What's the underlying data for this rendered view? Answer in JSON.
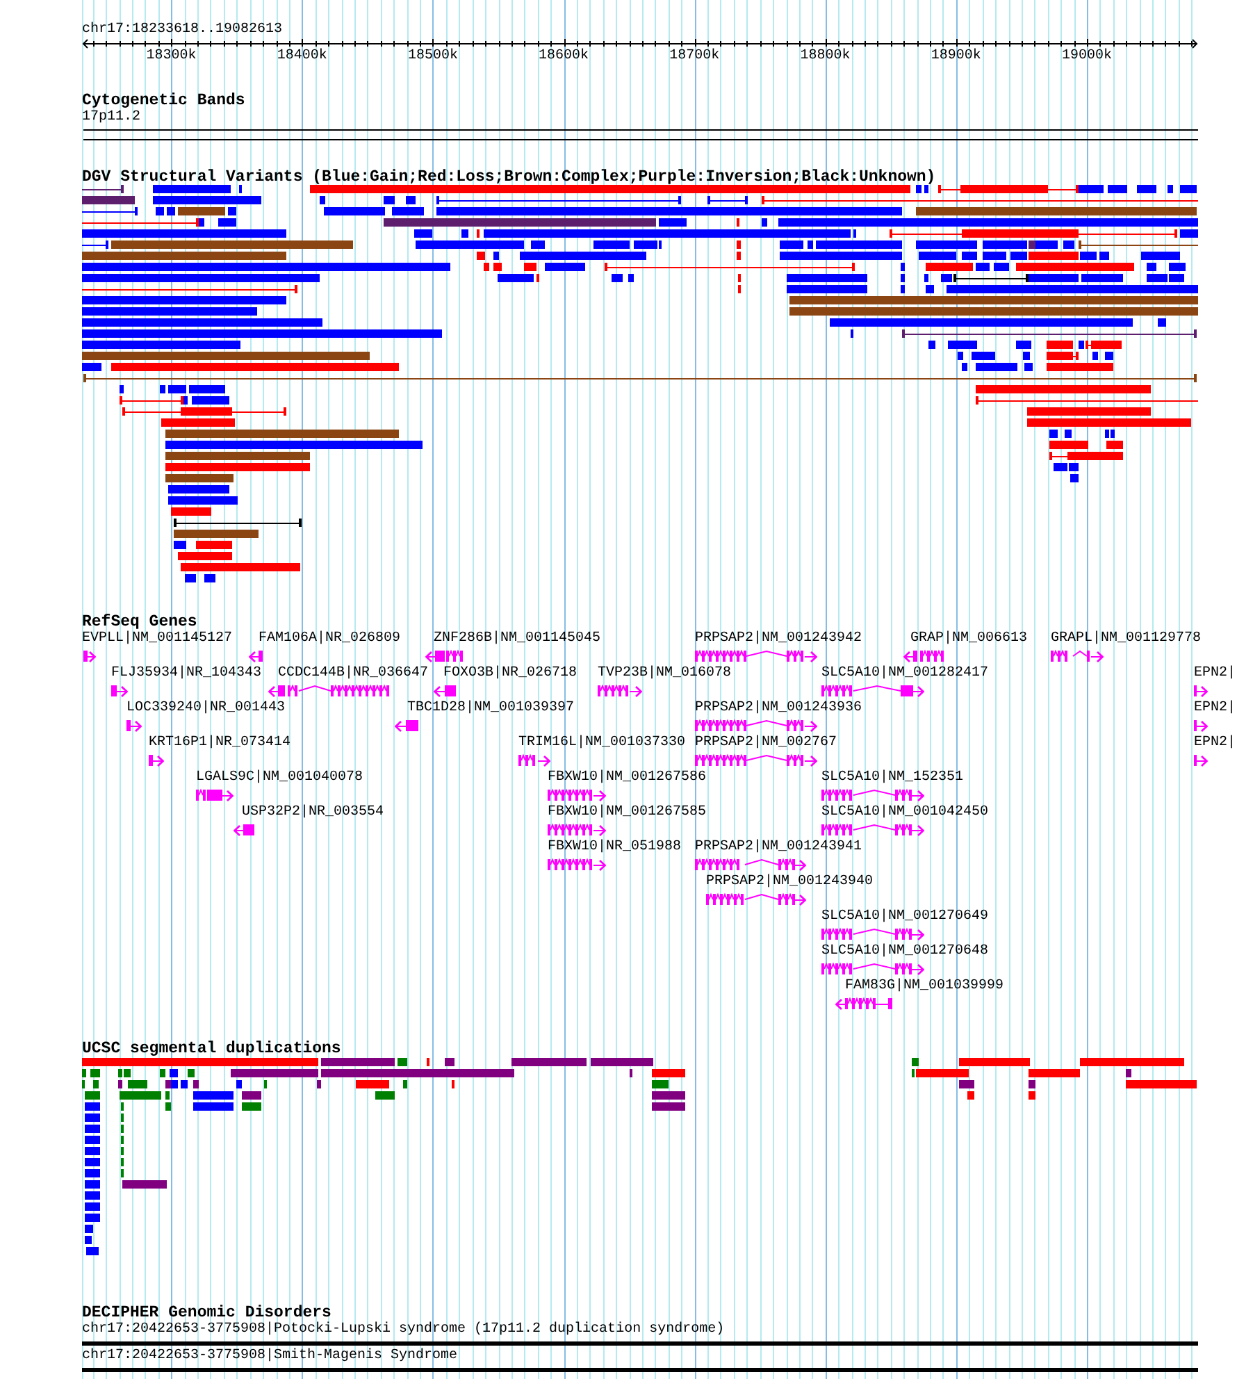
{
  "ruler": {
    "region": "chr17:18233618..19082613",
    "ticks": [
      "18300k",
      "18400k",
      "18500k",
      "18600k",
      "18700k",
      "18800k",
      "18900k",
      "19000k"
    ]
  },
  "cytogenetic_bands": {
    "title": "Cytogenetic Bands",
    "bands": [
      {
        "label": "17p11.2"
      }
    ]
  },
  "dgv_structural_variants": {
    "title": "DGV Structural Variants (Blue:Gain;Red:Loss;Brown:Complex;Purple:Inversion;Black:Unknown)",
    "features": [
      {
        "color": "#5e1e6e",
        "kind": "span"
      },
      {
        "color": "#0000ff",
        "kind": "block"
      },
      {
        "color": "#0000ff",
        "kind": "block"
      },
      {
        "color": "#ff0000",
        "kind": "block"
      },
      {
        "color": "#0000ff",
        "kind": "block"
      },
      {
        "color": "#0000ff",
        "kind": "block"
      },
      {
        "color": "#ff0000",
        "kind": "span"
      },
      {
        "color": "#ff0000",
        "kind": "block"
      },
      {
        "color": "#0000ff",
        "kind": "block"
      },
      {
        "color": "#0000ff",
        "kind": "block"
      },
      {
        "color": "#0000ff",
        "kind": "block"
      },
      {
        "color": "#0000ff",
        "kind": "block"
      },
      {
        "color": "#0000ff",
        "kind": "block"
      },
      {
        "color": "#5e1e6e",
        "kind": "block"
      },
      {
        "color": "#0000ff",
        "kind": "block"
      },
      {
        "color": "#0000ff",
        "kind": "block"
      },
      {
        "color": "#0000ff",
        "kind": "block"
      },
      {
        "color": "#0000ff",
        "kind": "block"
      },
      {
        "color": "#0000ff",
        "kind": "span"
      },
      {
        "color": "#0000ff",
        "kind": "span"
      },
      {
        "color": "#ff0000",
        "kind": "span"
      },
      {
        "color": "#0000ff",
        "kind": "span"
      },
      {
        "color": "#0000ff",
        "kind": "block"
      },
      {
        "color": "#0000ff",
        "kind": "block"
      },
      {
        "color": "#8b4513",
        "kind": "block"
      },
      {
        "color": "#0000ff",
        "kind": "block"
      },
      {
        "color": "#0000ff",
        "kind": "block"
      },
      {
        "color": "#0000ff",
        "kind": "block"
      },
      {
        "color": "#0000ff",
        "kind": "block"
      },
      {
        "color": "#8b4513",
        "kind": "block"
      },
      {
        "color": "#ff0000",
        "kind": "span"
      },
      {
        "color": "#0000ff",
        "kind": "block"
      },
      {
        "color": "#0000ff",
        "kind": "block"
      },
      {
        "color": "#5e1e6e",
        "kind": "block"
      },
      {
        "color": "#0000ff",
        "kind": "block"
      },
      {
        "color": "#ff0000",
        "kind": "block"
      },
      {
        "color": "#0000ff",
        "kind": "block"
      },
      {
        "color": "#0000ff",
        "kind": "block"
      },
      {
        "color": "#0000ff",
        "kind": "block"
      },
      {
        "color": "#0000ff",
        "kind": "block"
      },
      {
        "color": "#0000ff",
        "kind": "block"
      },
      {
        "color": "#ff0000",
        "kind": "block"
      },
      {
        "color": "#0000ff",
        "kind": "block"
      },
      {
        "color": "#0000ff",
        "kind": "block"
      },
      {
        "color": "#ff0000",
        "kind": "span"
      },
      {
        "color": "#ff0000",
        "kind": "block"
      },
      {
        "color": "#0000ff",
        "kind": "block"
      },
      {
        "color": "#0000ff",
        "kind": "span"
      },
      {
        "color": "#8b4513",
        "kind": "block"
      },
      {
        "color": "#0000ff",
        "kind": "block"
      },
      {
        "color": "#0000ff",
        "kind": "block"
      },
      {
        "color": "#0000ff",
        "kind": "block"
      },
      {
        "color": "#0000ff",
        "kind": "block"
      },
      {
        "color": "#0000ff",
        "kind": "block"
      },
      {
        "color": "#ff0000",
        "kind": "block"
      },
      {
        "color": "#0000ff",
        "kind": "block"
      },
      {
        "color": "#0000ff",
        "kind": "block"
      },
      {
        "color": "#0000ff",
        "kind": "block"
      },
      {
        "color": "#0000ff",
        "kind": "block"
      },
      {
        "color": "#0000ff",
        "kind": "block"
      },
      {
        "color": "#5e1e6e",
        "kind": "block"
      },
      {
        "color": "#0000ff",
        "kind": "block"
      },
      {
        "color": "#0000ff",
        "kind": "block"
      },
      {
        "color": "#8b4513",
        "kind": "span"
      },
      {
        "color": "#8b4513",
        "kind": "block"
      },
      {
        "color": "#ff0000",
        "kind": "block"
      },
      {
        "color": "#0000ff",
        "kind": "block"
      },
      {
        "color": "#0000ff",
        "kind": "block"
      },
      {
        "color": "#ff0000",
        "kind": "block"
      },
      {
        "color": "#0000ff",
        "kind": "block"
      },
      {
        "color": "#0000ff",
        "kind": "block"
      },
      {
        "color": "#0000ff",
        "kind": "block"
      },
      {
        "color": "#0000ff",
        "kind": "block"
      },
      {
        "color": "#0000ff",
        "kind": "block"
      },
      {
        "color": "#ff0000",
        "kind": "block"
      },
      {
        "color": "#0000ff",
        "kind": "block"
      },
      {
        "color": "#0000ff",
        "kind": "block"
      },
      {
        "color": "#0000ff",
        "kind": "block"
      },
      {
        "color": "#0000ff",
        "kind": "block"
      },
      {
        "color": "#ff0000",
        "kind": "block"
      },
      {
        "color": "#ff0000",
        "kind": "block"
      },
      {
        "color": "#ff0000",
        "kind": "block"
      },
      {
        "color": "#0000ff",
        "kind": "block"
      },
      {
        "color": "#ff0000",
        "kind": "span"
      },
      {
        "color": "#0000ff",
        "kind": "block"
      },
      {
        "color": "#ff0000",
        "kind": "block"
      },
      {
        "color": "#0000ff",
        "kind": "block"
      },
      {
        "color": "#0000ff",
        "kind": "block"
      },
      {
        "color": "#ff0000",
        "kind": "block"
      },
      {
        "color": "#0000ff",
        "kind": "block"
      },
      {
        "color": "#0000ff",
        "kind": "block"
      },
      {
        "color": "#0000ff",
        "kind": "block"
      },
      {
        "color": "#0000ff",
        "kind": "block"
      },
      {
        "color": "#ff0000",
        "kind": "block"
      },
      {
        "color": "#0000ff",
        "kind": "block"
      },
      {
        "color": "#0000ff",
        "kind": "block"
      },
      {
        "color": "#ff0000",
        "kind": "block"
      },
      {
        "color": "#0000ff",
        "kind": "block"
      },
      {
        "color": "#0000ff",
        "kind": "block"
      },
      {
        "color": "#0000ff",
        "kind": "block"
      },
      {
        "color": "#0000ff",
        "kind": "block"
      },
      {
        "color": "#000000",
        "kind": "span"
      },
      {
        "color": "#0000ff",
        "kind": "block"
      },
      {
        "color": "#0000ff",
        "kind": "block"
      },
      {
        "color": "#0000ff",
        "kind": "block"
      },
      {
        "color": "#0000ff",
        "kind": "block"
      },
      {
        "color": "#ff0000",
        "kind": "span"
      },
      {
        "color": "#ff0000",
        "kind": "block"
      },
      {
        "color": "#0000ff",
        "kind": "block"
      },
      {
        "color": "#0000ff",
        "kind": "block"
      },
      {
        "color": "#0000ff",
        "kind": "block"
      },
      {
        "color": "#0000ff",
        "kind": "block"
      },
      {
        "color": "#0000ff",
        "kind": "block"
      },
      {
        "color": "#8b4513",
        "kind": "block"
      },
      {
        "color": "#0000ff",
        "kind": "block"
      },
      {
        "color": "#8b4513",
        "kind": "block"
      },
      {
        "color": "#0000ff",
        "kind": "block"
      },
      {
        "color": "#0000ff",
        "kind": "block"
      },
      {
        "color": "#0000ff",
        "kind": "block"
      },
      {
        "color": "#0000ff",
        "kind": "block"
      },
      {
        "color": "#0000ff",
        "kind": "block"
      },
      {
        "color": "#5e1e6e",
        "kind": "span"
      },
      {
        "color": "#0000ff",
        "kind": "block"
      },
      {
        "color": "#0000ff",
        "kind": "block"
      },
      {
        "color": "#0000ff",
        "kind": "block"
      },
      {
        "color": "#0000ff",
        "kind": "block"
      },
      {
        "color": "#ff0000",
        "kind": "block"
      },
      {
        "color": "#0000ff",
        "kind": "block"
      },
      {
        "color": "#ff0000",
        "kind": "span"
      },
      {
        "color": "#ff0000",
        "kind": "block"
      },
      {
        "color": "#8b4513",
        "kind": "block"
      },
      {
        "color": "#0000ff",
        "kind": "block"
      },
      {
        "color": "#0000ff",
        "kind": "block"
      },
      {
        "color": "#0000ff",
        "kind": "block"
      },
      {
        "color": "#ff0000",
        "kind": "span"
      },
      {
        "color": "#ff0000",
        "kind": "block"
      },
      {
        "color": "#0000ff",
        "kind": "block"
      },
      {
        "color": "#0000ff",
        "kind": "block"
      },
      {
        "color": "#0000ff",
        "kind": "block"
      },
      {
        "color": "#ff0000",
        "kind": "block"
      },
      {
        "color": "#0000ff",
        "kind": "block"
      },
      {
        "color": "#0000ff",
        "kind": "block"
      },
      {
        "color": "#0000ff",
        "kind": "block"
      },
      {
        "color": "#ff0000",
        "kind": "block"
      },
      {
        "color": "#8b4513",
        "kind": "span"
      },
      {
        "color": "#0000ff",
        "kind": "block"
      },
      {
        "color": "#0000ff",
        "kind": "block"
      },
      {
        "color": "#0000ff",
        "kind": "block"
      },
      {
        "color": "#0000ff",
        "kind": "block"
      },
      {
        "color": "#ff0000",
        "kind": "block"
      },
      {
        "color": "#ff0000",
        "kind": "span"
      },
      {
        "color": "#0000ff",
        "kind": "block"
      },
      {
        "color": "#0000ff",
        "kind": "block"
      },
      {
        "color": "#ff0000",
        "kind": "span"
      },
      {
        "color": "#ff0000",
        "kind": "span"
      },
      {
        "color": "#ff0000",
        "kind": "block"
      },
      {
        "color": "#ff0000",
        "kind": "block"
      },
      {
        "color": "#ff0000",
        "kind": "block"
      },
      {
        "color": "#ff0000",
        "kind": "block"
      },
      {
        "color": "#8b4513",
        "kind": "block"
      },
      {
        "color": "#0000ff",
        "kind": "block"
      },
      {
        "color": "#0000ff",
        "kind": "block"
      },
      {
        "color": "#0000ff",
        "kind": "block"
      },
      {
        "color": "#0000ff",
        "kind": "block"
      },
      {
        "color": "#0000ff",
        "kind": "block"
      },
      {
        "color": "#ff0000",
        "kind": "block"
      },
      {
        "color": "#ff0000",
        "kind": "block"
      },
      {
        "color": "#8b4513",
        "kind": "block"
      },
      {
        "color": "#ff0000",
        "kind": "span"
      },
      {
        "color": "#ff0000",
        "kind": "block"
      },
      {
        "color": "#ff0000",
        "kind": "block"
      },
      {
        "color": "#0000ff",
        "kind": "block"
      },
      {
        "color": "#0000ff",
        "kind": "block"
      },
      {
        "color": "#8b4513",
        "kind": "block"
      },
      {
        "color": "#0000ff",
        "kind": "block"
      },
      {
        "color": "#0000ff",
        "kind": "block"
      },
      {
        "color": "#0000ff",
        "kind": "block"
      },
      {
        "color": "#ff0000",
        "kind": "block"
      },
      {
        "color": "#000000",
        "kind": "span"
      },
      {
        "color": "#8b4513",
        "kind": "block"
      },
      {
        "color": "#0000ff",
        "kind": "block"
      },
      {
        "color": "#ff0000",
        "kind": "block"
      },
      {
        "color": "#ff0000",
        "kind": "block"
      },
      {
        "color": "#ff0000",
        "kind": "block"
      },
      {
        "color": "#0000ff",
        "kind": "block"
      },
      {
        "color": "#0000ff",
        "kind": "block"
      }
    ]
  },
  "refseq_genes": {
    "title": "RefSeq Genes",
    "genes": [
      {
        "label": "EVPLL|NM_001145127",
        "kind": "forward"
      },
      {
        "label": "FAM106A|NR_026809",
        "kind": "reverse"
      },
      {
        "label": "ZNF286B|NM_001145045",
        "kind": "reverse"
      },
      {
        "label": "PRPSAP2|NM_001243942",
        "kind": "forward"
      },
      {
        "label": "GRAP|NM_006613",
        "kind": "reverse"
      },
      {
        "label": "GRAPL|NM_001129778",
        "kind": "forward"
      },
      {
        "label": "FLJ35934|NR_104343",
        "kind": "forward"
      },
      {
        "label": "CCDC144B|NR_036647",
        "kind": "reverse"
      },
      {
        "label": "FOXO3B|NR_026718",
        "kind": "reverse"
      },
      {
        "label": "TVP23B|NM_016078",
        "kind": "forward"
      },
      {
        "label": "SLC5A10|NM_001282417",
        "kind": "forward"
      },
      {
        "label": "EPN2|",
        "kind": "forward"
      },
      {
        "label": "LOC339240|NR_001443",
        "kind": "forward"
      },
      {
        "label": "TBC1D28|NM_001039397",
        "kind": "reverse"
      },
      {
        "label": "PRPSAP2|NM_001243936",
        "kind": "forward"
      },
      {
        "label": "EPN2|",
        "kind": "forward"
      },
      {
        "label": "KRT16P1|NR_073414",
        "kind": "forward"
      },
      {
        "label": "TRIM16L|NM_001037330",
        "kind": "forward"
      },
      {
        "label": "PRPSAP2|NM_002767",
        "kind": "forward"
      },
      {
        "label": "EPN2|",
        "kind": "forward"
      },
      {
        "label": "LGALS9C|NM_001040078",
        "kind": "forward"
      },
      {
        "label": "FBXW10|NM_001267586",
        "kind": "forward"
      },
      {
        "label": "SLC5A10|NM_152351",
        "kind": "forward"
      },
      {
        "label": "USP32P2|NR_003554",
        "kind": "reverse"
      },
      {
        "label": "FBXW10|NM_001267585",
        "kind": "forward"
      },
      {
        "label": "SLC5A10|NM_001042450",
        "kind": "forward"
      },
      {
        "label": "FBXW10|NR_051988",
        "kind": "forward"
      },
      {
        "label": "PRPSAP2|NM_001243941",
        "kind": "forward"
      },
      {
        "label": "PRPSAP2|NM_001243940",
        "kind": "forward"
      },
      {
        "label": "SLC5A10|NM_001270649",
        "kind": "forward"
      },
      {
        "label": "SLC5A10|NM_001270648",
        "kind": "forward"
      },
      {
        "label": "FAM83G|NM_001039999",
        "kind": "reverse"
      }
    ]
  },
  "segmental_duplications": {
    "title": "UCSC segmental duplications",
    "features": [
      {
        "color": "#ff0000"
      },
      {
        "color": "#800080"
      },
      {
        "color": "#008000"
      },
      {
        "color": "#ff0000"
      },
      {
        "color": "#800080"
      },
      {
        "color": "#800080"
      },
      {
        "color": "#800080"
      },
      {
        "color": "#008000"
      },
      {
        "color": "#ff0000"
      },
      {
        "color": "#ff0000"
      },
      {
        "color": "#008000"
      },
      {
        "color": "#008000"
      },
      {
        "color": "#008000"
      },
      {
        "color": "#008000"
      },
      {
        "color": "#008000"
      },
      {
        "color": "#0000ff"
      },
      {
        "color": "#008000"
      },
      {
        "color": "#800080"
      },
      {
        "color": "#800080"
      },
      {
        "color": "#800080"
      },
      {
        "color": "#ff0000"
      },
      {
        "color": "#008000"
      },
      {
        "color": "#ff0000"
      },
      {
        "color": "#ff0000"
      },
      {
        "color": "#800080"
      },
      {
        "color": "#008000"
      },
      {
        "color": "#008000"
      },
      {
        "color": "#800080"
      },
      {
        "color": "#008000"
      },
      {
        "color": "#800080"
      },
      {
        "color": "#0000ff"
      },
      {
        "color": "#0000ff"
      },
      {
        "color": "#800080"
      },
      {
        "color": "#0000ff"
      },
      {
        "color": "#008000"
      },
      {
        "color": "#800080"
      },
      {
        "color": "#ff0000"
      },
      {
        "color": "#008000"
      },
      {
        "color": "#ff0000"
      },
      {
        "color": "#008000"
      },
      {
        "color": "#800080"
      },
      {
        "color": "#800080"
      },
      {
        "color": "#ff0000"
      },
      {
        "color": "#008000"
      },
      {
        "color": "#008000"
      },
      {
        "color": "#008000"
      },
      {
        "color": "#0000ff"
      },
      {
        "color": "#800080"
      },
      {
        "color": "#008000"
      },
      {
        "color": "#800080"
      },
      {
        "color": "#ff0000"
      },
      {
        "color": "#ff0000"
      },
      {
        "color": "#0000ff"
      },
      {
        "color": "#008000"
      },
      {
        "color": "#008000"
      },
      {
        "color": "#0000ff"
      },
      {
        "color": "#008000"
      },
      {
        "color": "#800080"
      },
      {
        "color": "#0000ff"
      },
      {
        "color": "#008000"
      },
      {
        "color": "#0000ff"
      },
      {
        "color": "#008000"
      },
      {
        "color": "#0000ff"
      },
      {
        "color": "#008000"
      },
      {
        "color": "#0000ff"
      },
      {
        "color": "#008000"
      },
      {
        "color": "#0000ff"
      },
      {
        "color": "#008000"
      },
      {
        "color": "#0000ff"
      },
      {
        "color": "#008000"
      },
      {
        "color": "#0000ff"
      },
      {
        "color": "#800080"
      },
      {
        "color": "#0000ff"
      },
      {
        "color": "#0000ff"
      },
      {
        "color": "#0000ff"
      },
      {
        "color": "#0000ff"
      },
      {
        "color": "#0000ff"
      },
      {
        "color": "#0000ff"
      }
    ]
  },
  "decipher_genomic_disorders": {
    "title": "DECIPHER Genomic Disorders",
    "disorders": [
      {
        "label": "chr17:20422653-3775908|Potocki-Lupski syndrome (17p11.2 duplication syndrome)"
      },
      {
        "label": "chr17:20422653-3775908|Smith-Magenis Syndrome"
      }
    ]
  }
}
